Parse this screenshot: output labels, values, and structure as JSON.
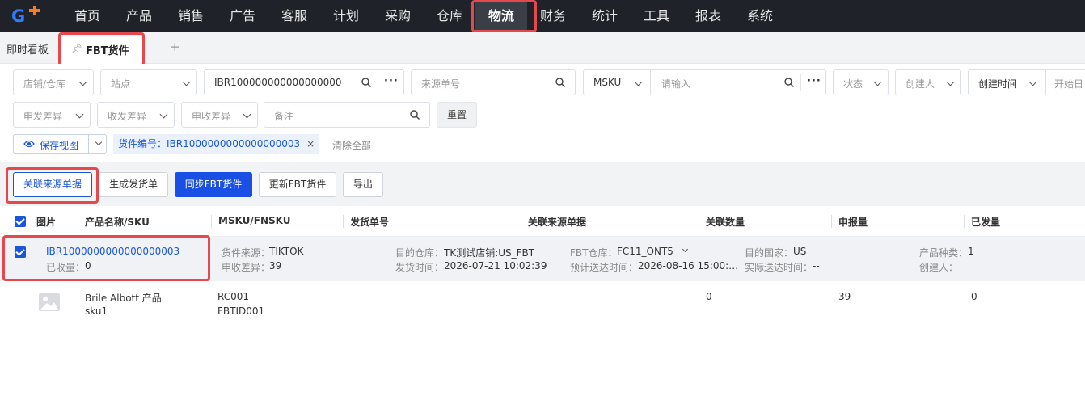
{
  "nav": {
    "logo": "G",
    "items": [
      "首页",
      "产品",
      "销售",
      "广告",
      "客服",
      "计划",
      "采购",
      "仓库",
      "物流",
      "财务",
      "统计",
      "工具",
      "报表",
      "系统"
    ],
    "active": "物流"
  },
  "tabs": {
    "dashboard": "即时看板",
    "current": "FBT货件",
    "add": "+"
  },
  "filters": {
    "shop_warehouse": "店铺/仓库",
    "site": "站点",
    "shipment_no_value": "IBR100000000000000000",
    "source_no": "来源单号",
    "msku_select": "MSKU",
    "msku_placeholder": "请输入",
    "status": "状态",
    "creator": "创建人",
    "created_time": "创建时间",
    "start_date": "开始日",
    "declare_diff": "申发差异",
    "receive_diff": "收发差异",
    "declare_receive_diff": "申收差异",
    "remark": "备注",
    "reset": "重置",
    "save_view": "保存视图",
    "chip": "货件编号：IBR1000000000000000003",
    "chip_close": "×",
    "clear_all": "清除全部"
  },
  "actions": {
    "link_source": "关联来源单据",
    "generate_shipment": "生成发货单",
    "sync_fbt": "同步FBT货件",
    "update_fbt": "更新FBT货件",
    "export": "导出"
  },
  "table": {
    "headers": [
      "图片",
      "产品名称/SKU",
      "MSKU/FNSKU",
      "发货单号",
      "关联来源单据",
      "关联数量",
      "申报量",
      "已发量"
    ],
    "group": {
      "shipment_id": "IBR1000000000000000003",
      "received_label": "已收量：",
      "received_value": "0",
      "source_label": "货件来源：",
      "source_value": "TIKTOK",
      "diff_label": "申收差异：",
      "diff_value": "39",
      "dest_wh_label": "目的仓库：",
      "dest_wh_value": "TK测试店铺:US_FBT",
      "ship_time_label": "发货时间：",
      "ship_time_value": "2026-07-21 10:02:39",
      "fbt_wh_label": "FBT仓库：",
      "fbt_wh_value": "FC11_ONT5",
      "eta_label": "预计送达时间：",
      "eta_value": "2026-08-16 15:00:…",
      "country_label": "目的国家：",
      "country_value": "US",
      "actual_label": "实际送达时间：",
      "actual_value": "--",
      "category_label": "产品种类：",
      "category_value": "1",
      "creator_label": "创建人：",
      "creator_value": ""
    },
    "rows": [
      {
        "product_name": "Brile Albott 产品",
        "sku": "sku1",
        "msku": "RC001",
        "fnsku": "FBTID001",
        "shipment_no": "--",
        "source_doc": "--",
        "linked_qty": "0",
        "declared_qty": "39",
        "shipped_qty": "0"
      }
    ]
  },
  "colors": {
    "nav_bg": "#1f2329",
    "primary": "#1a4fe6",
    "link": "#1a56db",
    "highlight": "#e5484d"
  }
}
